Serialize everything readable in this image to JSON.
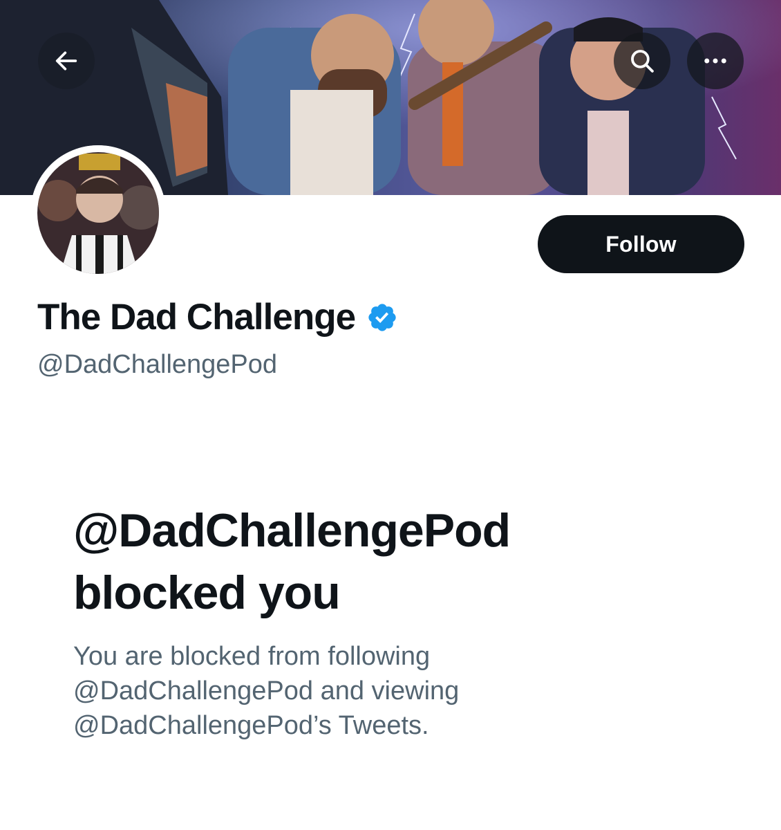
{
  "header": {
    "back_icon": "arrow-left-icon",
    "search_icon": "search-icon",
    "more_icon": "more-horizontal-icon"
  },
  "profile": {
    "display_name": "The Dad Challenge",
    "verified": true,
    "verified_color": "#1d9bf0",
    "handle": "@DadChallengePod",
    "follow_label": "Follow"
  },
  "blocked": {
    "title_line1": "@DadChallengePod",
    "title_line2": "blocked you",
    "desc_line1": "You are blocked from following",
    "desc_line2": "@DadChallengePod and viewing",
    "desc_line3": "@DadChallengePod’s Tweets."
  },
  "colors": {
    "text_primary": "#0f1419",
    "text_secondary": "#536471",
    "button_dark": "#0f1419",
    "accent": "#1d9bf0"
  }
}
